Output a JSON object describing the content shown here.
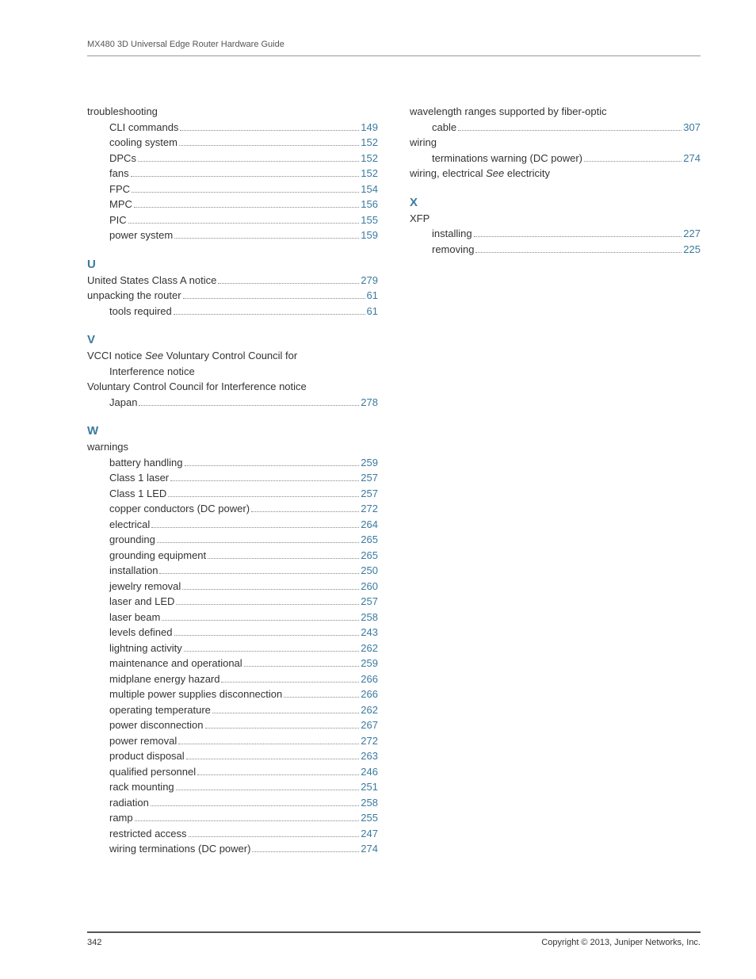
{
  "header": {
    "title": "MX480 3D Universal Edge Router Hardware Guide"
  },
  "footer": {
    "page": "342",
    "copyright": "Copyright © 2013, Juniper Networks, Inc."
  },
  "left": [
    {
      "type": "entry",
      "indent": 0,
      "label": "troubleshooting"
    },
    {
      "type": "entry",
      "indent": 1,
      "label": "CLI commands",
      "page": "149"
    },
    {
      "type": "entry",
      "indent": 1,
      "label": "cooling system",
      "page": "152"
    },
    {
      "type": "entry",
      "indent": 1,
      "label": "DPCs",
      "page": "152"
    },
    {
      "type": "entry",
      "indent": 1,
      "label": "fans",
      "page": "152"
    },
    {
      "type": "entry",
      "indent": 1,
      "label": "FPC",
      "page": "154"
    },
    {
      "type": "entry",
      "indent": 1,
      "label": "MPC",
      "page": "156"
    },
    {
      "type": "entry",
      "indent": 1,
      "label": "PIC",
      "page": "155"
    },
    {
      "type": "entry",
      "indent": 1,
      "label": "power system",
      "page": "159"
    },
    {
      "type": "letter",
      "label": "U"
    },
    {
      "type": "entry",
      "indent": 0,
      "label": "United States Class A notice",
      "page": "279"
    },
    {
      "type": "entry",
      "indent": 0,
      "label": "unpacking the router",
      "page": "61"
    },
    {
      "type": "entry",
      "indent": 1,
      "label": "tools required",
      "page": "61"
    },
    {
      "type": "letter",
      "label": "V"
    },
    {
      "type": "entry",
      "indent": 0,
      "label_parts": [
        {
          "t": "VCCI notice "
        },
        {
          "t": "See",
          "i": true
        },
        {
          "t": " Voluntary Control Council for"
        }
      ]
    },
    {
      "type": "entry",
      "indent": 1,
      "label": "Interference notice"
    },
    {
      "type": "entry",
      "indent": 0,
      "label": "Voluntary Control Council for Interference notice"
    },
    {
      "type": "entry",
      "indent": 1,
      "label": "Japan",
      "page": "278"
    },
    {
      "type": "letter",
      "label": "W"
    },
    {
      "type": "entry",
      "indent": 0,
      "label": "warnings"
    },
    {
      "type": "entry",
      "indent": 1,
      "label": "battery handling",
      "page": "259"
    },
    {
      "type": "entry",
      "indent": 1,
      "label": "Class 1 laser",
      "page": "257"
    },
    {
      "type": "entry",
      "indent": 1,
      "label": "Class 1 LED",
      "page": "257"
    },
    {
      "type": "entry",
      "indent": 1,
      "label": "copper conductors (DC power)",
      "page": "272"
    },
    {
      "type": "entry",
      "indent": 1,
      "label": "electrical",
      "page": "264"
    },
    {
      "type": "entry",
      "indent": 1,
      "label": "grounding",
      "page": "265"
    },
    {
      "type": "entry",
      "indent": 1,
      "label": "grounding equipment ",
      "page": "265"
    },
    {
      "type": "entry",
      "indent": 1,
      "label": "installation",
      "page": "250"
    },
    {
      "type": "entry",
      "indent": 1,
      "label": "jewelry removal",
      "page": "260"
    },
    {
      "type": "entry",
      "indent": 1,
      "label": "laser and LED",
      "page": "257"
    },
    {
      "type": "entry",
      "indent": 1,
      "label": "laser beam",
      "page": "258"
    },
    {
      "type": "entry",
      "indent": 1,
      "label": "levels defined",
      "page": "243"
    },
    {
      "type": "entry",
      "indent": 1,
      "label": "lightning activity",
      "page": "262"
    },
    {
      "type": "entry",
      "indent": 1,
      "label": "maintenance and operational",
      "page": "259"
    },
    {
      "type": "entry",
      "indent": 1,
      "label": "midplane energy hazard ",
      "page": "266"
    },
    {
      "type": "entry",
      "indent": 1,
      "label": "multiple power supplies disconnection",
      "page": "266"
    },
    {
      "type": "entry",
      "indent": 1,
      "label": "operating temperature",
      "page": "262"
    },
    {
      "type": "entry",
      "indent": 1,
      "label": "power disconnection",
      "page": "267"
    },
    {
      "type": "entry",
      "indent": 1,
      "label": "power removal",
      "page": "272"
    },
    {
      "type": "entry",
      "indent": 1,
      "label": "product disposal",
      "page": "263"
    },
    {
      "type": "entry",
      "indent": 1,
      "label": "qualified personnel",
      "page": "246"
    },
    {
      "type": "entry",
      "indent": 1,
      "label": "rack mounting",
      "page": "251"
    },
    {
      "type": "entry",
      "indent": 1,
      "label": "radiation",
      "page": "258"
    },
    {
      "type": "entry",
      "indent": 1,
      "label": "ramp",
      "page": "255"
    },
    {
      "type": "entry",
      "indent": 1,
      "label": "restricted access",
      "page": "247"
    },
    {
      "type": "entry",
      "indent": 1,
      "label": "wiring terminations (DC power)",
      "page": "274"
    }
  ],
  "right": [
    {
      "type": "entry",
      "indent": 0,
      "label": "wavelength ranges supported by fiber-optic"
    },
    {
      "type": "entry",
      "indent": 1,
      "label": "cable",
      "page": "307"
    },
    {
      "type": "entry",
      "indent": 0,
      "label": "wiring"
    },
    {
      "type": "entry",
      "indent": 1,
      "label": "terminations warning (DC power)",
      "page": "274"
    },
    {
      "type": "entry",
      "indent": 0,
      "label_parts": [
        {
          "t": "wiring, electrical "
        },
        {
          "t": "See",
          "i": true
        },
        {
          "t": " electricity"
        }
      ]
    },
    {
      "type": "letter",
      "label": "X"
    },
    {
      "type": "entry",
      "indent": 0,
      "label": "XFP"
    },
    {
      "type": "entry",
      "indent": 1,
      "label": "installing",
      "page": "227"
    },
    {
      "type": "entry",
      "indent": 1,
      "label": "removing",
      "page": "225"
    }
  ]
}
